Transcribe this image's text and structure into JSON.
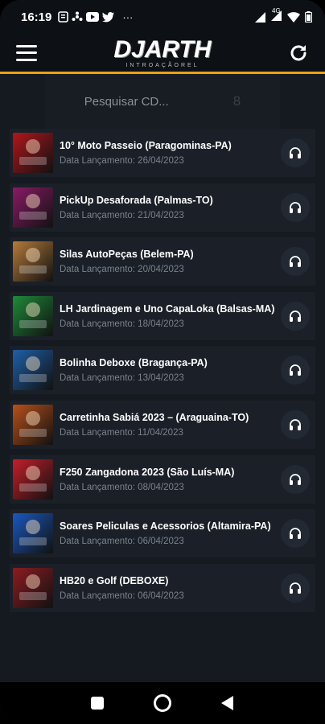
{
  "status": {
    "time": "16:19",
    "left_icons": [
      "doc-icon",
      "fan-icon",
      "youtube-icon",
      "twitter-icon"
    ],
    "more": "···",
    "network": "4G"
  },
  "header": {
    "logo_text": "DJARTH",
    "logo_sub": "INTROAÇÃOREL"
  },
  "search": {
    "placeholder": "Pesquisar CD...",
    "count": "8"
  },
  "items": [
    {
      "title": "10° Moto Passeio (Paragominas-PA)",
      "date": "Data Lançamento: 26/04/2023",
      "color": "#b0161c"
    },
    {
      "title": "PickUp Desaforada (Palmas-TO)",
      "date": "Data Lançamento: 21/04/2023",
      "color": "#8a1a66"
    },
    {
      "title": "Silas AutoPeças (Belem-PA)",
      "date": "Data Lançamento: 20/04/2023",
      "color": "#b57b3a"
    },
    {
      "title": "LH Jardinagem e Uno CapaLoka (Balsas-MA)",
      "date": "Data Lançamento: 18/04/2023",
      "color": "#1f8a3a"
    },
    {
      "title": "Bolinha Deboxe (Bragança-PA)",
      "date": "Data Lançamento: 13/04/2023",
      "color": "#1f5fa8"
    },
    {
      "title": "Carretinha Sabiá 2023 – (Araguaina-TO)",
      "date": "Data Lançamento: 11/04/2023",
      "color": "#b8501a"
    },
    {
      "title": "F250 Zangadona 2023 (São Luís-MA)",
      "date": "Data Lançamento: 08/04/2023",
      "color": "#c41e2a"
    },
    {
      "title": "Soares Peliculas e Acessorios (Altamira-PA)",
      "date": "Data Lançamento: 06/04/2023",
      "color": "#1a58c0"
    },
    {
      "title": "HB20 e Golf (DEBOXE)",
      "date": "Data Lançamento: 06/04/2023",
      "color": "#8c1c22"
    }
  ],
  "colors": {
    "accent": "#e9a30f",
    "background": "#151a21",
    "card": "#1b2028",
    "muted_text": "#7b818a"
  }
}
